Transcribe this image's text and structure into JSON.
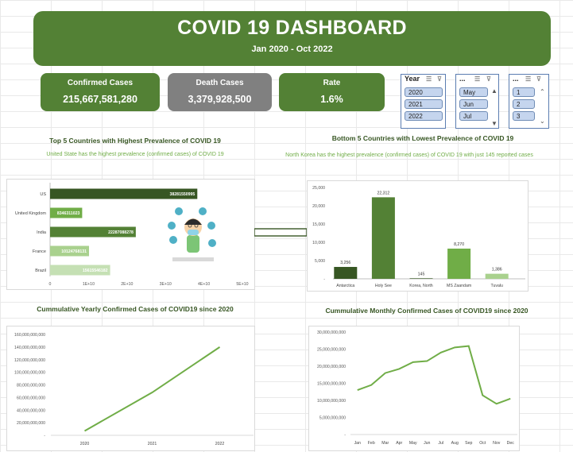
{
  "header": {
    "title": "COVID 19 DASHBOARD",
    "subtitle": "Jan 2020 - Oct 2022"
  },
  "kpis": [
    {
      "label": "Confirmed Cases",
      "value": "215,667,581,280",
      "color": "#538135"
    },
    {
      "label": "Death Cases",
      "value": "3,379,928,500",
      "color": "#808080"
    },
    {
      "label": "Rate",
      "value": "1.6%",
      "color": "#538135"
    }
  ],
  "slicers": {
    "year": {
      "title": "Year",
      "items": [
        "2020",
        "2021",
        "2022"
      ]
    },
    "month": {
      "title": "...",
      "items": [
        "May",
        "Jun",
        "Jul"
      ]
    },
    "day": {
      "title": "...",
      "items": [
        "1",
        "2",
        "3"
      ]
    }
  },
  "colors": {
    "dark_green": "#375623",
    "mid_green": "#538135",
    "light_green": "#70ad47",
    "pale_green": "#a9d18e",
    "gray": "#808080"
  },
  "chart_data": [
    {
      "type": "bar",
      "orientation": "horizontal",
      "title": "Top 5 Countries with Highest Prevalence of COVID 19",
      "subtitle": "United State has the highest prevalence (confirmed cases) of COVID 19",
      "categories": [
        "US",
        "United Kingdom",
        "India",
        "France",
        "Brazil"
      ],
      "values": [
        38281550995,
        8346311023,
        22287088278,
        10124768131,
        15615546182
      ],
      "value_labels": [
        "38281550995",
        "8346311023",
        "22287088278",
        "10124768131",
        "15615546182"
      ],
      "tick_labels": [
        "0",
        "1E+10",
        "2E+10",
        "3E+10",
        "4E+10",
        "5E+10"
      ],
      "xlim": [
        0,
        50000000000
      ],
      "colors": [
        "#375623",
        "#70ad47",
        "#538135",
        "#a9d18e",
        "#c5e0b4"
      ]
    },
    {
      "type": "bar",
      "title": "Bottom 5 Countries with Lowest Prevalence of COVID 19",
      "subtitle": "North Korea has the highest prevalence (confirmed cases) of COVID 19 with just 145 reported cases",
      "categories": [
        "Antarctica",
        "Holy See",
        "Korea, North",
        "MS Zaandam",
        "Tuvalu"
      ],
      "values": [
        3256,
        22312,
        145,
        8270,
        1386
      ],
      "value_labels": [
        "3,256",
        "22,312",
        "145",
        "8,270",
        "1,386"
      ],
      "tick_labels": [
        "-",
        "5,000",
        "10,000",
        "15,000",
        "20,000",
        "25,000"
      ],
      "ylim": [
        0,
        25000
      ],
      "colors": [
        "#375623",
        "#538135",
        "#375623",
        "#70ad47",
        "#a9d18e"
      ]
    },
    {
      "type": "line",
      "title": "Cummulative Yearly Confirmed Cases of COVID19 since 2020",
      "x": [
        "2020",
        "2021",
        "2022"
      ],
      "values": [
        7000000000,
        68000000000,
        140000000000
      ],
      "tick_labels": [
        "-",
        "20,000,000,000",
        "40,000,000,000",
        "60,000,000,000",
        "80,000,000,000",
        "100,000,000,000",
        "120,000,000,000",
        "140,000,000,000",
        "160,000,000,000"
      ],
      "ylim": [
        0,
        160000000000
      ],
      "color": "#70ad47"
    },
    {
      "type": "line",
      "title": "Cummulative Monthly Confirmed Cases of COVID19 since 2020",
      "x": [
        "Jan",
        "Feb",
        "Mar",
        "Apr",
        "May",
        "Jun",
        "Jul",
        "Aug",
        "Sep",
        "Oct",
        "Nov",
        "Dec"
      ],
      "values": [
        13000000000,
        14500000000,
        18000000000,
        19200000000,
        21200000000,
        21500000000,
        24000000000,
        25500000000,
        25900000000,
        11500000000,
        9000000000,
        10500000000
      ],
      "tick_labels": [
        "-",
        "5,000,000,000",
        "10,000,000,000",
        "15,000,000,000",
        "20,000,000,000",
        "25,000,000,000",
        "30,000,000,000"
      ],
      "ylim": [
        0,
        30000000000
      ],
      "color": "#70ad47"
    }
  ]
}
